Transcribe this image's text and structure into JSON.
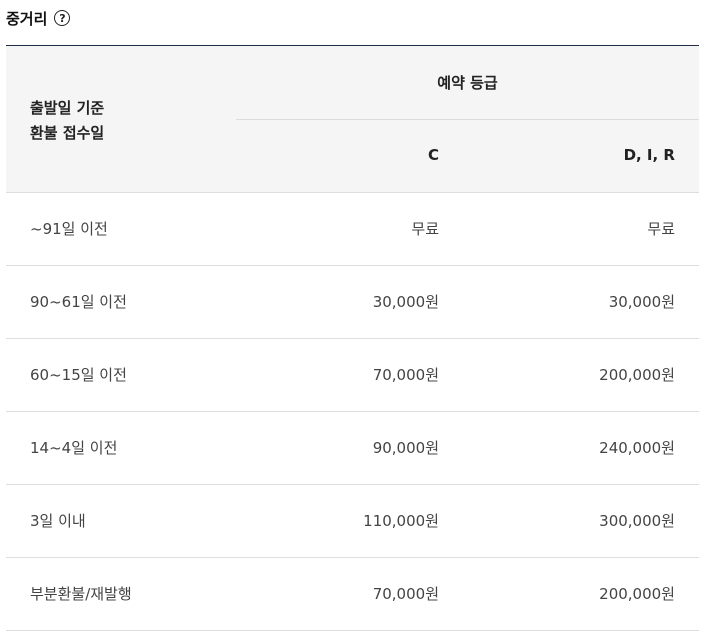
{
  "section": {
    "title": "중거리",
    "help_icon": "question-circle-icon"
  },
  "table": {
    "header": {
      "left_line1": "출발일 기준",
      "left_line2": "환불 접수일",
      "group_label": "예약 등급",
      "col_c": "C",
      "col_d": "D, I, R"
    },
    "rows": [
      {
        "label": "~91일 이전",
        "c": "무료",
        "d": "무료"
      },
      {
        "label": "90~61일 이전",
        "c": "30,000원",
        "d": "30,000원"
      },
      {
        "label": "60~15일 이전",
        "c": "70,000원",
        "d": "200,000원"
      },
      {
        "label": "14~4일 이전",
        "c": "90,000원",
        "d": "240,000원"
      },
      {
        "label": "3일 이내",
        "c": "110,000원",
        "d": "300,000원"
      },
      {
        "label": "부분환불/재발행",
        "c": "70,000원",
        "d": "200,000원"
      }
    ]
  },
  "colors": {
    "header_bg": "#f5f5f5",
    "top_border": "#1e2a4a",
    "row_border": "#dddddd"
  }
}
